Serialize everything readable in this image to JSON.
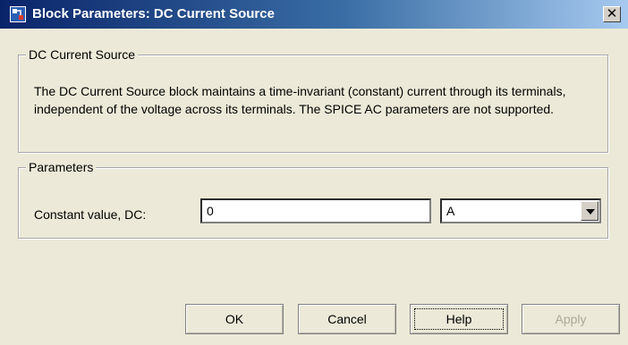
{
  "window": {
    "title": "Block Parameters: DC Current Source",
    "close_label": "✕"
  },
  "description_group": {
    "legend": "DC Current Source",
    "text": "The DC Current Source block maintains a time-invariant (constant) current through its terminals, independent of the voltage across its terminals. The SPICE AC parameters are not supported."
  },
  "parameters_group": {
    "legend": "Parameters",
    "constant_value_label": "Constant value, DC:",
    "constant_value": "0",
    "unit_value": "A"
  },
  "buttons": {
    "ok": "OK",
    "cancel": "Cancel",
    "help": "Help",
    "apply": "Apply"
  },
  "colors": {
    "title_gradient_start": "#0a246a",
    "title_gradient_end": "#a6caf0",
    "dialog_background": "#ece9d8"
  }
}
